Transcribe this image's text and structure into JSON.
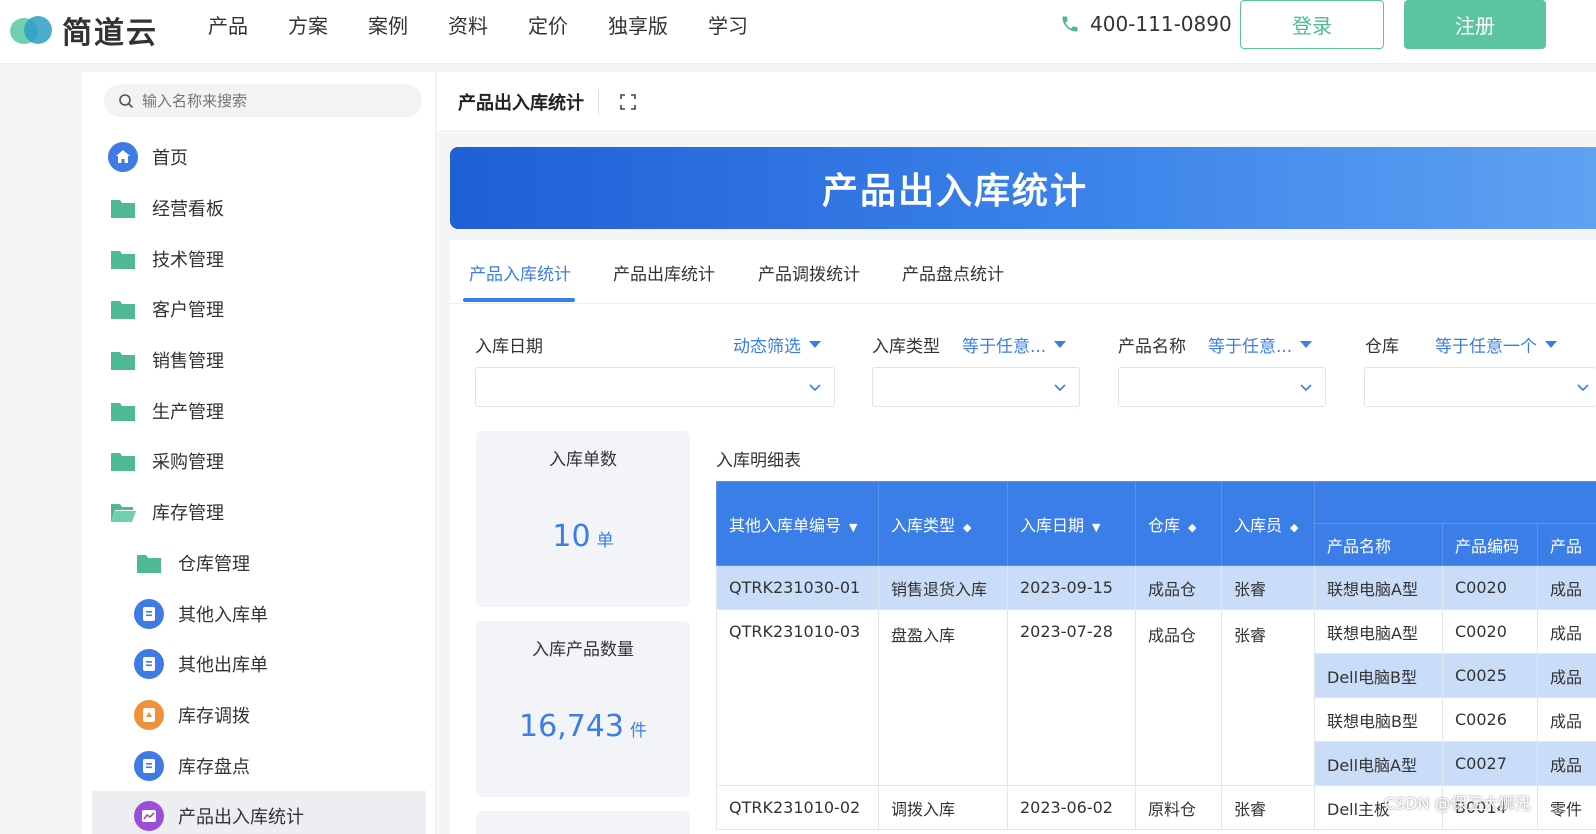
{
  "brand": {
    "name": "简道云"
  },
  "nav": {
    "items": [
      "产品",
      "方案",
      "案例",
      "资料",
      "定价",
      "独享版",
      "学习"
    ]
  },
  "contact": {
    "phone": "400-111-0890"
  },
  "auth": {
    "login_label": "登录",
    "register_label": "注册"
  },
  "sidebar": {
    "search_placeholder": "输入名称来搜索",
    "items": [
      {
        "label": "首页",
        "icon": "home-icon",
        "level": 1
      },
      {
        "label": "经营看板",
        "icon": "folder-icon",
        "level": 1
      },
      {
        "label": "技术管理",
        "icon": "folder-icon",
        "level": 1
      },
      {
        "label": "客户管理",
        "icon": "folder-icon",
        "level": 1
      },
      {
        "label": "销售管理",
        "icon": "folder-icon",
        "level": 1
      },
      {
        "label": "生产管理",
        "icon": "folder-icon",
        "level": 1
      },
      {
        "label": "采购管理",
        "icon": "folder-icon",
        "level": 1
      },
      {
        "label": "库存管理",
        "icon": "folder-open-icon",
        "level": 1
      },
      {
        "label": "仓库管理",
        "icon": "folder-icon",
        "level": 2
      },
      {
        "label": "其他入库单",
        "icon": "form-icon",
        "level": 2
      },
      {
        "label": "其他出库单",
        "icon": "form-icon",
        "level": 2
      },
      {
        "label": "库存调拨",
        "icon": "transfer-icon",
        "level": 2
      },
      {
        "label": "库存盘点",
        "icon": "form-icon",
        "level": 2
      },
      {
        "label": "产品出入库统计",
        "icon": "chart-icon",
        "level": 2,
        "active": true
      }
    ]
  },
  "page": {
    "title": "产品出入库统计",
    "banner_title": "产品出入库统计"
  },
  "tabs": [
    {
      "label": "产品入库统计",
      "active": true
    },
    {
      "label": "产品出库统计",
      "active": false
    },
    {
      "label": "产品调拨统计",
      "active": false
    },
    {
      "label": "产品盘点统计",
      "active": false
    }
  ],
  "filters": [
    {
      "label": "入库日期",
      "mode": "动态筛选"
    },
    {
      "label": "入库类型",
      "mode": "等于任意..."
    },
    {
      "label": "产品名称",
      "mode": "等于任意..."
    },
    {
      "label": "仓库",
      "mode": "等于任意一个"
    }
  ],
  "stats": [
    {
      "label": "入库单数",
      "value": "10",
      "unit": "单"
    },
    {
      "label": "入库产品数量",
      "value": "16,743",
      "unit": "件"
    }
  ],
  "table": {
    "title": "入库明细表",
    "columns": [
      "其他入库单编号",
      "入库类型",
      "入库日期",
      "仓库",
      "入库员"
    ],
    "sub_columns": [
      "产品名称",
      "产品编码",
      "产品"
    ],
    "rows": [
      {
        "code": "QTRK231030-01",
        "type": "销售退货入库",
        "date": "2023-09-15",
        "warehouse": "成品仓",
        "staff": "张睿",
        "items": [
          {
            "name": "联想电脑A型",
            "sku": "C0020",
            "extra": "成品"
          }
        ]
      },
      {
        "code": "QTRK231010-03",
        "type": "盘盈入库",
        "date": "2023-07-28",
        "warehouse": "成品仓",
        "staff": "张睿",
        "items": [
          {
            "name": "联想电脑A型",
            "sku": "C0020",
            "extra": "成品"
          },
          {
            "name": "Dell电脑B型",
            "sku": "C0025",
            "extra": "成品"
          },
          {
            "name": "联想电脑B型",
            "sku": "C0026",
            "extra": "成品"
          },
          {
            "name": "Dell电脑A型",
            "sku": "C0027",
            "extra": "成品"
          }
        ]
      },
      {
        "code": "QTRK231010-02",
        "type": "调拨入库",
        "date": "2023-06-02",
        "warehouse": "原料仓",
        "staff": "张睿",
        "items": [
          {
            "name": "Dell主板",
            "sku": "B0014",
            "extra": "零件"
          }
        ]
      }
    ]
  },
  "watermark": "CSDN @保卫大狮兄",
  "colors": {
    "brand_green": "#5bc4a0",
    "primary_blue": "#3b7ee8",
    "highlight_row": "#c9dcf8"
  }
}
